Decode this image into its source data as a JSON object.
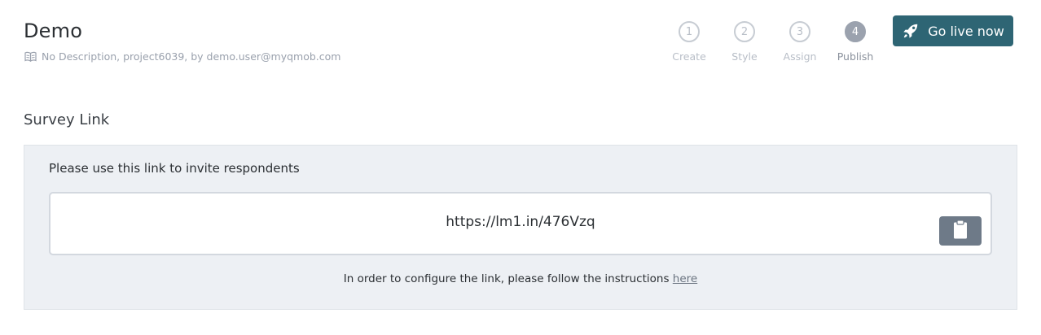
{
  "header": {
    "title": "Demo",
    "subtitle": "No Description, project6039, by demo.user@myqmob.com",
    "subtitle_icon": "book-icon"
  },
  "steps": [
    {
      "number": "1",
      "label": "Create",
      "active": false
    },
    {
      "number": "2",
      "label": "Style",
      "active": false
    },
    {
      "number": "3",
      "label": "Assign",
      "active": false
    },
    {
      "number": "4",
      "label": "Publish",
      "active": true
    }
  ],
  "go_live": {
    "label": "Go live now",
    "icon": "rocket-icon",
    "color": "#2e6574"
  },
  "survey_link": {
    "section_title": "Survey Link",
    "instruction": "Please use this link to invite respondents",
    "url": "https://lm1.in/476Vzq",
    "copy_icon": "clipboard-icon",
    "footnote_text": "In order to configure the link, please follow the instructions",
    "footnote_link": "here"
  }
}
